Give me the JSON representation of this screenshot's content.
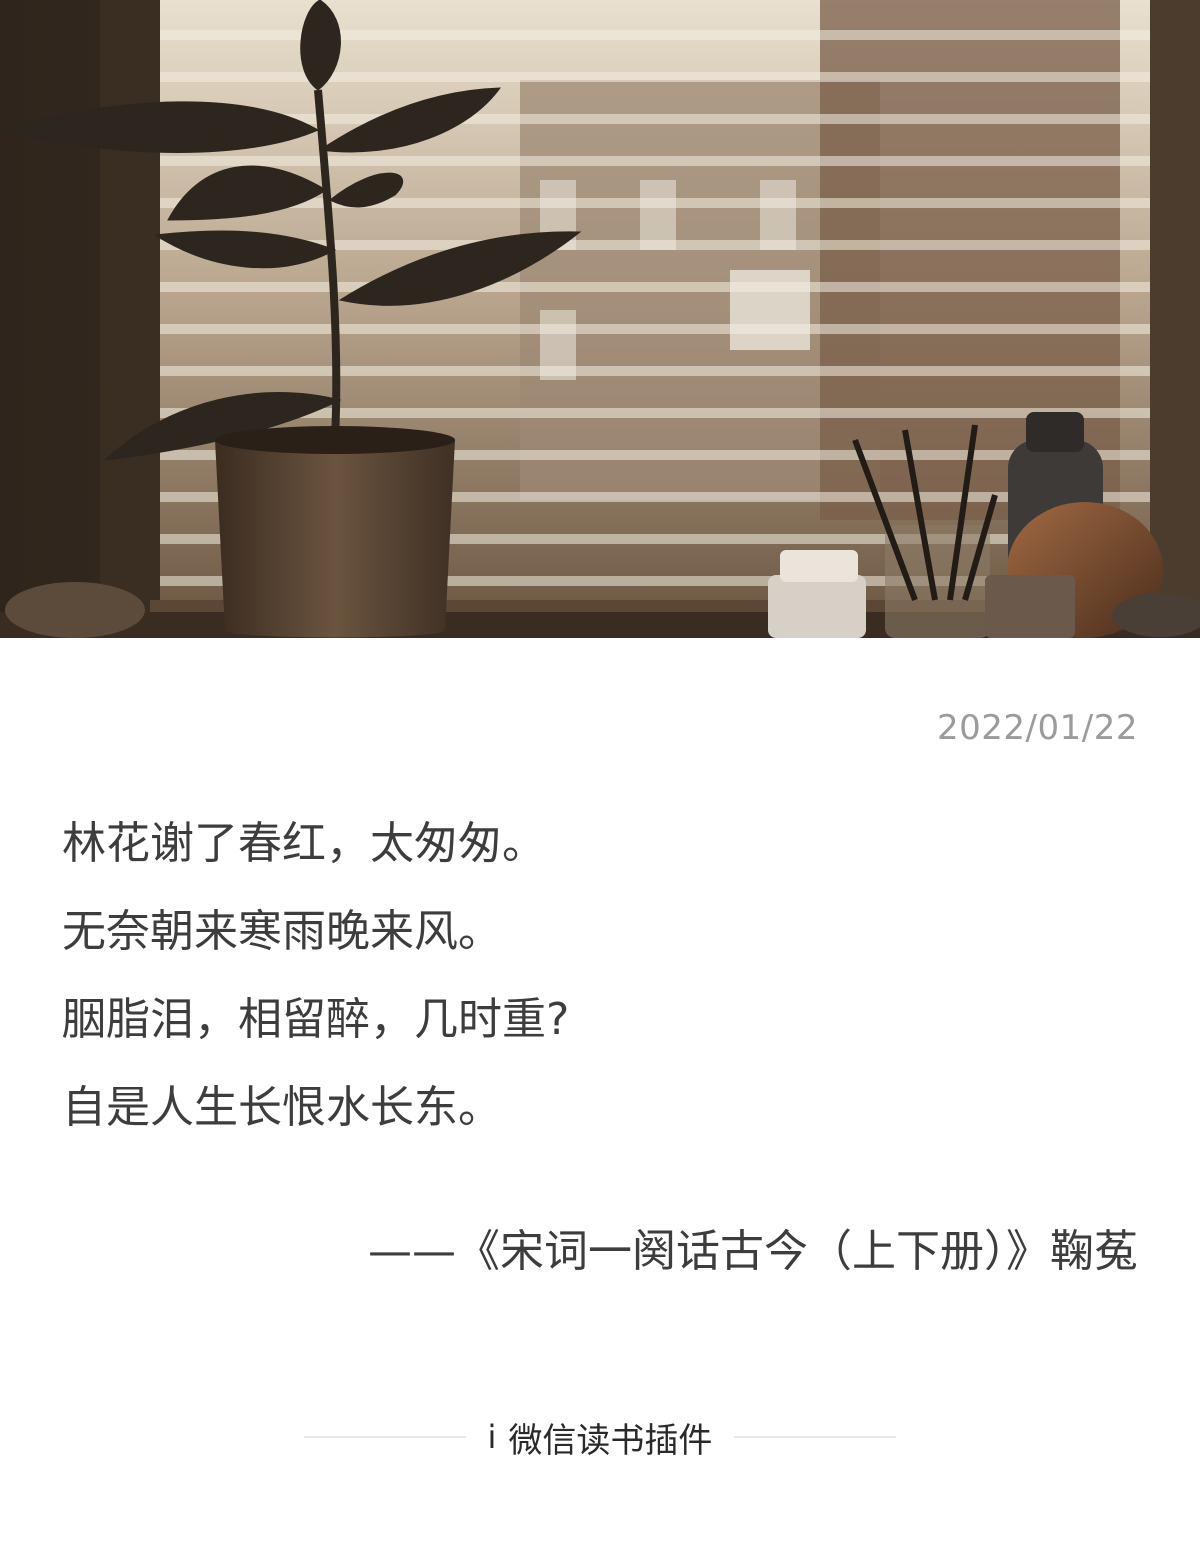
{
  "hero": {
    "description_icon": "window-plant-photo"
  },
  "card": {
    "date": "2022/01/22",
    "poem_lines": [
      "林花谢了春红，太匆匆。",
      "无奈朝来寒雨晚来风。",
      "胭脂泪，相留醉，几时重?",
      "自是人生长恨水长东。"
    ],
    "source": "——《宋词一阕话古今（上下册）》鞠菟"
  },
  "footer": {
    "icon": "i",
    "brand": "微信读书插件"
  },
  "colors": {
    "text": "#3d3d3d",
    "date": "#9b9b9b",
    "rule": "#e9e9e9"
  }
}
